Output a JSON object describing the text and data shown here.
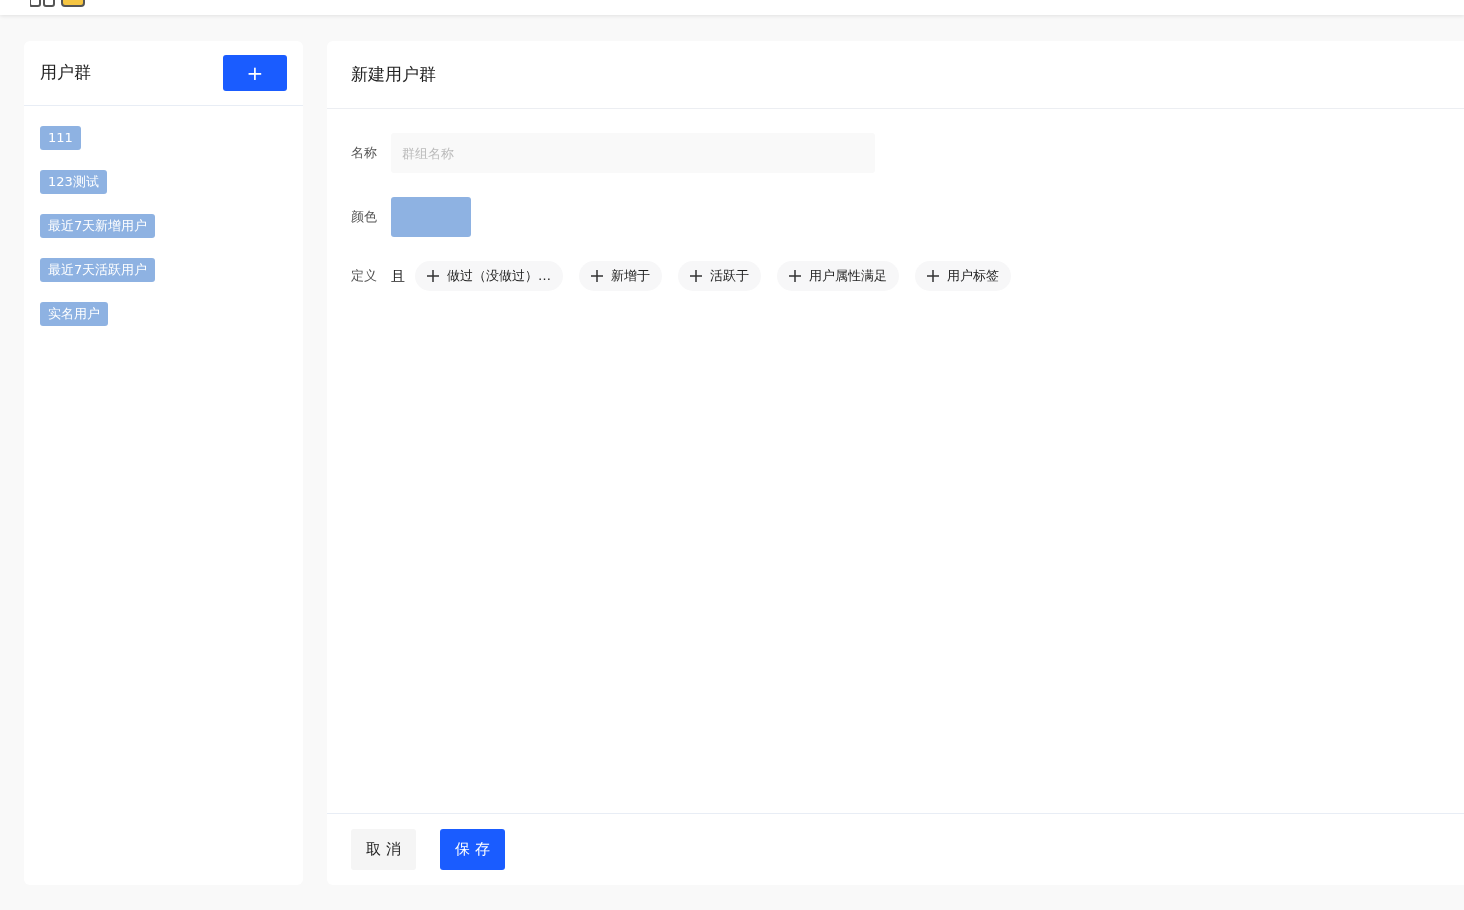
{
  "sidebar": {
    "title": "用户群",
    "add_button": "+",
    "groups": [
      {
        "label": "111",
        "color": "#8eb2e2"
      },
      {
        "label": "123测试",
        "color": "#8eb2e2"
      },
      {
        "label": "最近7天新增用户",
        "color": "#8eb2e2"
      },
      {
        "label": "最近7天活跃用户",
        "color": "#8eb2e2"
      },
      {
        "label": "实名用户",
        "color": "#8eb2e2"
      }
    ]
  },
  "form": {
    "title": "新建用户群",
    "name_label": "名称",
    "name_placeholder": "群组名称",
    "color_label": "颜色",
    "color": "#8eb2e2",
    "definition_label": "定义",
    "connector": "且",
    "conditions": [
      "做过（没做过）…",
      "新增于",
      "活跃于",
      "用户属性满足",
      "用户标签"
    ],
    "buttons": [
      {
        "label": "取 消",
        "kind": "secondary"
      },
      {
        "label": "保 存",
        "kind": "primary"
      }
    ]
  }
}
